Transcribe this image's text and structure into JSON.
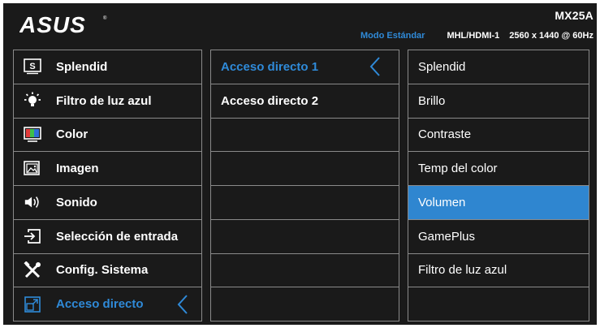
{
  "header": {
    "brand": "ASUS",
    "model": "MX25A",
    "mode": "Modo Estándar",
    "input": "MHL/HDMI-1",
    "resolution": "2560 x 1440 @ 60Hz"
  },
  "main_menu": {
    "items": [
      {
        "label": "Splendid",
        "icon": "splendid-icon"
      },
      {
        "label": "Filtro de luz azul",
        "icon": "blue-light-icon"
      },
      {
        "label": "Color",
        "icon": "color-icon"
      },
      {
        "label": "Imagen",
        "icon": "image-icon"
      },
      {
        "label": "Sonido",
        "icon": "speaker-icon"
      },
      {
        "label": "Selección de entrada",
        "icon": "input-select-icon"
      },
      {
        "label": "Config. Sistema",
        "icon": "tools-icon"
      },
      {
        "label": "Acceso directo",
        "icon": "shortcut-icon",
        "active": true
      }
    ]
  },
  "submenu": {
    "items": [
      {
        "label": "Acceso directo 1",
        "active": true
      },
      {
        "label": "Acceso directo 2"
      },
      {
        "label": ""
      },
      {
        "label": ""
      },
      {
        "label": ""
      },
      {
        "label": ""
      },
      {
        "label": ""
      },
      {
        "label": ""
      }
    ]
  },
  "options": {
    "items": [
      {
        "label": "Splendid"
      },
      {
        "label": "Brillo"
      },
      {
        "label": "Contraste"
      },
      {
        "label": "Temp del color"
      },
      {
        "label": "Volumen",
        "selected": true
      },
      {
        "label": "GamePlus"
      },
      {
        "label": "Filtro de luz azul"
      },
      {
        "label": ""
      }
    ]
  },
  "colors": {
    "background": "#1a1a1a",
    "accent": "#2f8ad8",
    "selection": "#2f86d0",
    "border": "#8a8a8a"
  }
}
